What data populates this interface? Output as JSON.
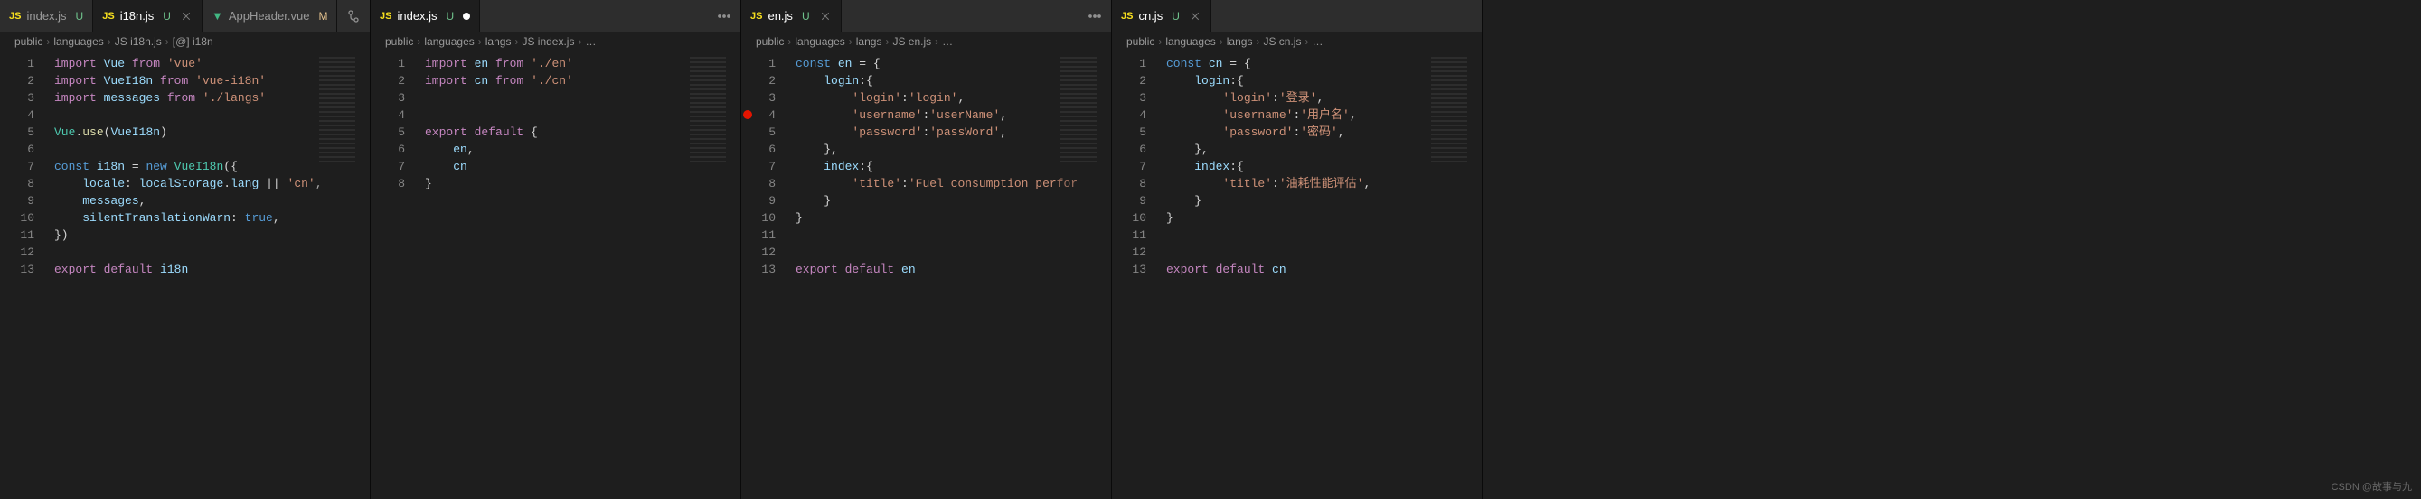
{
  "watermark": "CSDN @故事与九",
  "panes": [
    {
      "tabs": [
        {
          "icon": "js",
          "name": "index.js",
          "status": "U",
          "active": false,
          "dirty": false
        },
        {
          "icon": "js",
          "name": "i18n.js",
          "status": "U",
          "active": true,
          "dirty": false
        },
        {
          "icon": "vue",
          "name": "AppHeader.vue",
          "status": "M",
          "active": false,
          "dirty": false
        }
      ],
      "actions": [
        "compare",
        "split",
        "more"
      ],
      "breadcrumbs": [
        "public",
        "languages",
        "JS i18n.js",
        "[@] i18n"
      ],
      "breakpoints": [],
      "code": [
        [
          [
            "kw",
            "import"
          ],
          [
            "p",
            " "
          ],
          [
            "id",
            "Vue"
          ],
          [
            "p",
            " "
          ],
          [
            "kw",
            "from"
          ],
          [
            "p",
            " "
          ],
          [
            "str",
            "'vue'"
          ]
        ],
        [
          [
            "kw",
            "import"
          ],
          [
            "p",
            " "
          ],
          [
            "id",
            "VueI18n"
          ],
          [
            "p",
            " "
          ],
          [
            "kw",
            "from"
          ],
          [
            "p",
            " "
          ],
          [
            "str",
            "'vue-i18n'"
          ]
        ],
        [
          [
            "kw",
            "import"
          ],
          [
            "p",
            " "
          ],
          [
            "id",
            "messages"
          ],
          [
            "p",
            " "
          ],
          [
            "kw",
            "from"
          ],
          [
            "p",
            " "
          ],
          [
            "str",
            "'./langs'"
          ]
        ],
        [],
        [
          [
            "cls",
            "Vue"
          ],
          [
            "p",
            "."
          ],
          [
            "fn",
            "use"
          ],
          [
            "p",
            "("
          ],
          [
            "id",
            "VueI18n"
          ],
          [
            "p",
            ")"
          ]
        ],
        [],
        [
          [
            "bl",
            "const"
          ],
          [
            "p",
            " "
          ],
          [
            "id",
            "i18n"
          ],
          [
            "p",
            " = "
          ],
          [
            "bl",
            "new"
          ],
          [
            "p",
            " "
          ],
          [
            "cls",
            "VueI18n"
          ],
          [
            "p",
            "({"
          ]
        ],
        [
          [
            "p",
            "    "
          ],
          [
            "id",
            "locale"
          ],
          [
            "p",
            ": "
          ],
          [
            "id",
            "localStorage"
          ],
          [
            "p",
            "."
          ],
          [
            "id",
            "lang"
          ],
          [
            "p",
            " || "
          ],
          [
            "str",
            "'cn'"
          ],
          [
            "p",
            ","
          ]
        ],
        [
          [
            "p",
            "    "
          ],
          [
            "id",
            "messages"
          ],
          [
            "p",
            ","
          ]
        ],
        [
          [
            "p",
            "    "
          ],
          [
            "id",
            "silentTranslationWarn"
          ],
          [
            "p",
            ": "
          ],
          [
            "bl",
            "true"
          ],
          [
            "p",
            ","
          ]
        ],
        [
          [
            "p",
            "})"
          ]
        ],
        [],
        [
          [
            "kw",
            "export"
          ],
          [
            "p",
            " "
          ],
          [
            "kw",
            "default"
          ],
          [
            "p",
            " "
          ],
          [
            "id",
            "i18n"
          ]
        ]
      ]
    },
    {
      "tabs": [
        {
          "icon": "js",
          "name": "index.js",
          "status": "U",
          "active": true,
          "dirty": true
        }
      ],
      "actions": [
        "more"
      ],
      "breadcrumbs": [
        "public",
        "languages",
        "langs",
        "JS index.js",
        "…"
      ],
      "breakpoints": [],
      "code": [
        [
          [
            "kw",
            "import"
          ],
          [
            "p",
            " "
          ],
          [
            "id",
            "en"
          ],
          [
            "p",
            " "
          ],
          [
            "kw",
            "from"
          ],
          [
            "p",
            " "
          ],
          [
            "str",
            "'./en'"
          ]
        ],
        [
          [
            "kw",
            "import"
          ],
          [
            "p",
            " "
          ],
          [
            "id",
            "cn"
          ],
          [
            "p",
            " "
          ],
          [
            "kw",
            "from"
          ],
          [
            "p",
            " "
          ],
          [
            "str",
            "'./cn'"
          ]
        ],
        [],
        [],
        [
          [
            "kw",
            "export"
          ],
          [
            "p",
            " "
          ],
          [
            "kw",
            "default"
          ],
          [
            "p",
            " {"
          ]
        ],
        [
          [
            "p",
            "    "
          ],
          [
            "id",
            "en"
          ],
          [
            "p",
            ","
          ]
        ],
        [
          [
            "p",
            "    "
          ],
          [
            "id",
            "cn"
          ]
        ],
        [
          [
            "p",
            "}"
          ]
        ]
      ]
    },
    {
      "tabs": [
        {
          "icon": "js",
          "name": "en.js",
          "status": "U",
          "active": true,
          "dirty": false
        }
      ],
      "actions": [
        "more"
      ],
      "breadcrumbs": [
        "public",
        "languages",
        "langs",
        "JS en.js",
        "…"
      ],
      "breakpoints": [
        4
      ],
      "code": [
        [
          [
            "bl",
            "const"
          ],
          [
            "p",
            " "
          ],
          [
            "id",
            "en"
          ],
          [
            "p",
            " = {"
          ]
        ],
        [
          [
            "p",
            "    "
          ],
          [
            "id",
            "login"
          ],
          [
            "p",
            ":{"
          ]
        ],
        [
          [
            "p",
            "        "
          ],
          [
            "str",
            "'login'"
          ],
          [
            "p",
            ":"
          ],
          [
            "str",
            "'login'"
          ],
          [
            "p",
            ","
          ]
        ],
        [
          [
            "p",
            "        "
          ],
          [
            "str",
            "'username'"
          ],
          [
            "p",
            ":"
          ],
          [
            "str",
            "'userName'"
          ],
          [
            "p",
            ","
          ]
        ],
        [
          [
            "p",
            "        "
          ],
          [
            "str",
            "'password'"
          ],
          [
            "p",
            ":"
          ],
          [
            "str",
            "'passWord'"
          ],
          [
            "p",
            ","
          ]
        ],
        [
          [
            "p",
            "    },"
          ]
        ],
        [
          [
            "p",
            "    "
          ],
          [
            "id",
            "index"
          ],
          [
            "p",
            ":{"
          ]
        ],
        [
          [
            "p",
            "        "
          ],
          [
            "str",
            "'title'"
          ],
          [
            "p",
            ":"
          ],
          [
            "str",
            "'Fuel consumption perfor"
          ]
        ],
        [
          [
            "p",
            "    }"
          ]
        ],
        [
          [
            "p",
            "}"
          ]
        ],
        [],
        [],
        [
          [
            "kw",
            "export"
          ],
          [
            "p",
            " "
          ],
          [
            "kw",
            "default"
          ],
          [
            "p",
            " "
          ],
          [
            "id",
            "en"
          ]
        ]
      ]
    },
    {
      "tabs": [
        {
          "icon": "js",
          "name": "cn.js",
          "status": "U",
          "active": true,
          "dirty": false
        }
      ],
      "actions": [],
      "breadcrumbs": [
        "public",
        "languages",
        "langs",
        "JS cn.js",
        "…"
      ],
      "breakpoints": [],
      "code": [
        [
          [
            "bl",
            "const"
          ],
          [
            "p",
            " "
          ],
          [
            "id",
            "cn"
          ],
          [
            "p",
            " = {"
          ]
        ],
        [
          [
            "p",
            "    "
          ],
          [
            "id",
            "login"
          ],
          [
            "p",
            ":{"
          ]
        ],
        [
          [
            "p",
            "        "
          ],
          [
            "str",
            "'login'"
          ],
          [
            "p",
            ":"
          ],
          [
            "str",
            "'登录'"
          ],
          [
            "p",
            ","
          ]
        ],
        [
          [
            "p",
            "        "
          ],
          [
            "str",
            "'username'"
          ],
          [
            "p",
            ":"
          ],
          [
            "str",
            "'用户名'"
          ],
          [
            "p",
            ","
          ]
        ],
        [
          [
            "p",
            "        "
          ],
          [
            "str",
            "'password'"
          ],
          [
            "p",
            ":"
          ],
          [
            "str",
            "'密码'"
          ],
          [
            "p",
            ","
          ]
        ],
        [
          [
            "p",
            "    },"
          ]
        ],
        [
          [
            "p",
            "    "
          ],
          [
            "id",
            "index"
          ],
          [
            "p",
            ":{"
          ]
        ],
        [
          [
            "p",
            "        "
          ],
          [
            "str",
            "'title'"
          ],
          [
            "p",
            ":"
          ],
          [
            "str",
            "'油耗性能评估'"
          ],
          [
            "p",
            ","
          ]
        ],
        [
          [
            "p",
            "    }"
          ]
        ],
        [
          [
            "p",
            "}"
          ]
        ],
        [],
        [],
        [
          [
            "kw",
            "export"
          ],
          [
            "p",
            " "
          ],
          [
            "kw",
            "default"
          ],
          [
            "p",
            " "
          ],
          [
            "id",
            "cn"
          ]
        ]
      ]
    }
  ]
}
